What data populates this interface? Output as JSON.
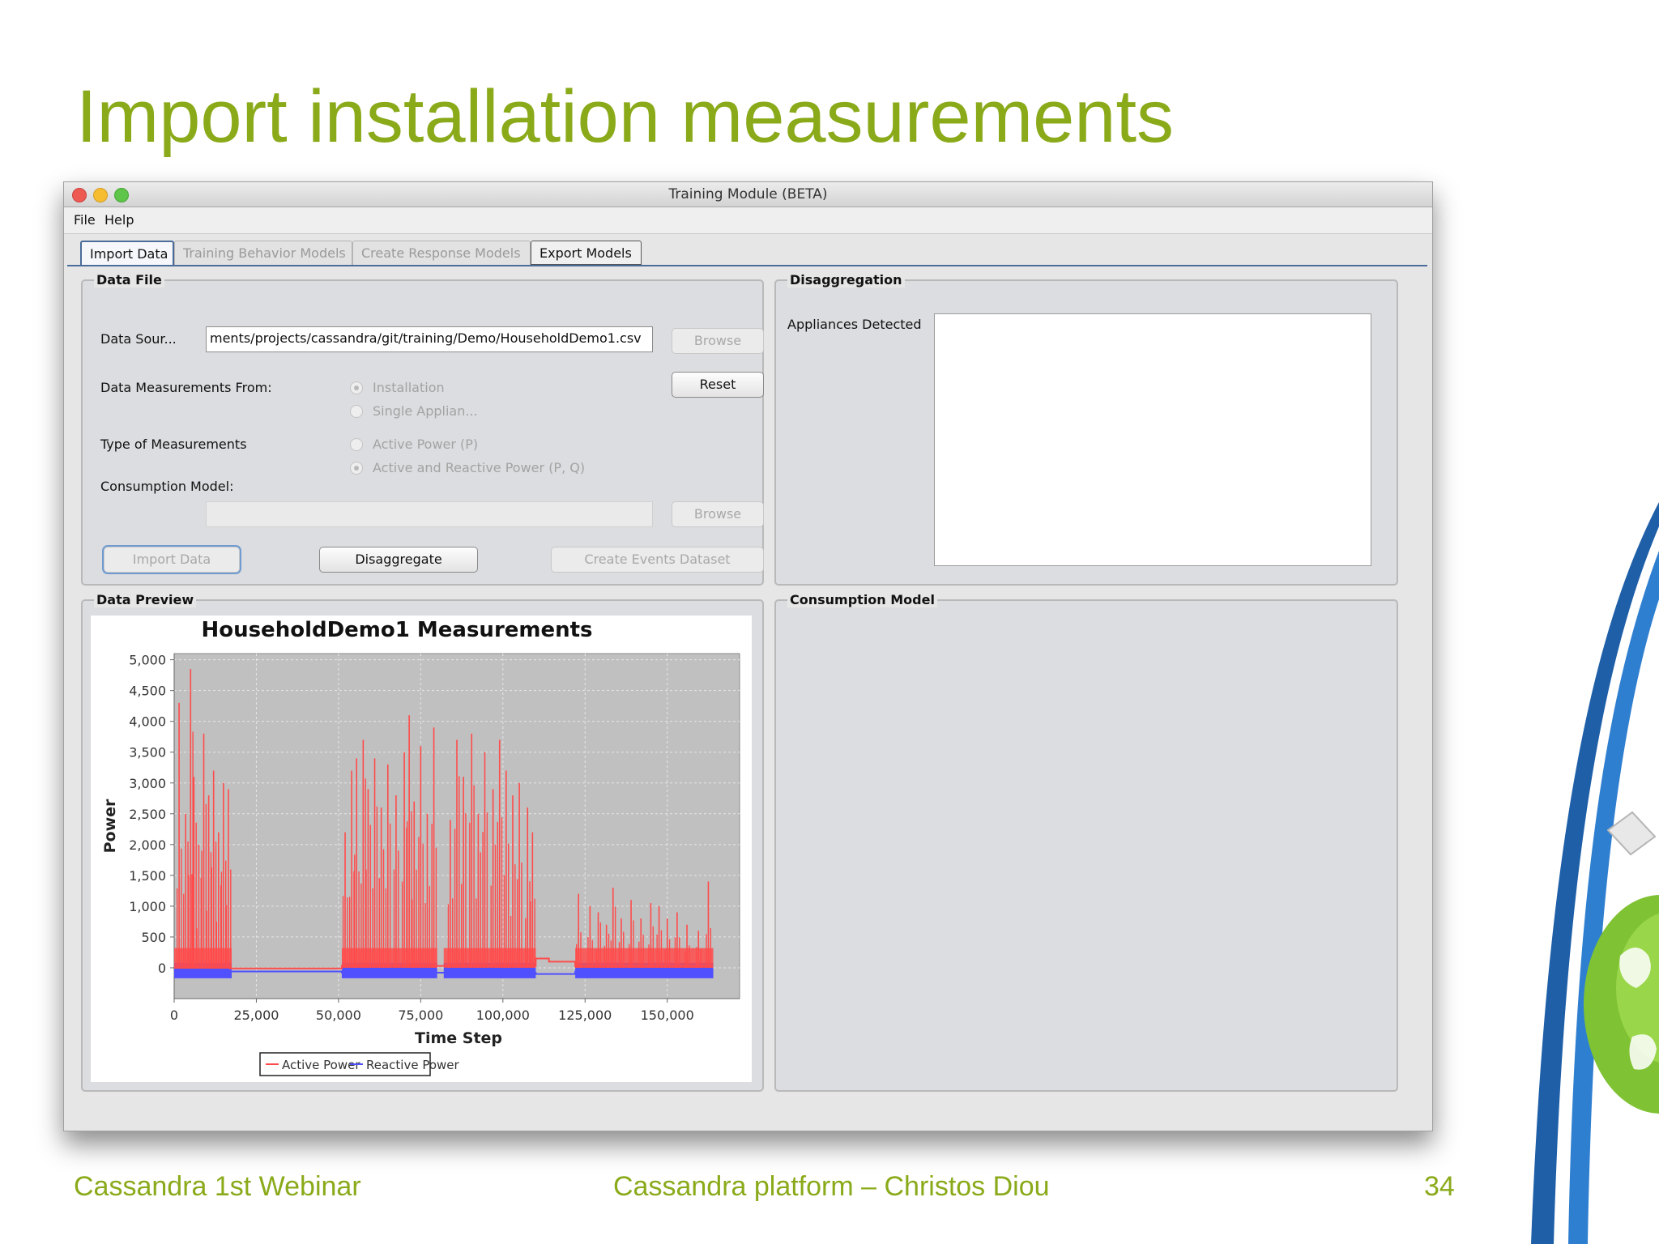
{
  "slide": {
    "title": "Import installation measurements",
    "footer_left": "Cassandra 1st Webinar",
    "footer_center": "Cassandra platform – Christos Diou",
    "page_number": "34"
  },
  "window": {
    "title": "Training Module (BETA)",
    "menu": [
      "File",
      "Help"
    ],
    "tabs": [
      {
        "label": "Import Data",
        "state": "active"
      },
      {
        "label": "Training Behavior Models",
        "state": "disabled"
      },
      {
        "label": "Create Response Models",
        "state": "disabled"
      },
      {
        "label": "Export Models",
        "state": "enabled"
      }
    ]
  },
  "data_file": {
    "group_title": "Data File",
    "source_label": "Data Sour...",
    "source_value": "ments/projects/cassandra/git/training/Demo/HouseholdDemo1.csv",
    "browse_label": "Browse",
    "reset_label": "Reset",
    "measurements_from_label": "Data Measurements From:",
    "measurements_from_options": [
      "Installation",
      "Single Applian..."
    ],
    "measurements_from_selected": "Installation",
    "type_label": "Type of Measurements",
    "type_options": [
      "Active Power (P)",
      "Active and Reactive Power (P, Q)"
    ],
    "type_selected": "Active and Reactive Power (P, Q)",
    "consumption_model_label": "Consumption Model:",
    "consumption_model_value": "",
    "browse2_label": "Browse",
    "import_button": "Import Data",
    "disaggregate_button": "Disaggregate",
    "create_events_button": "Create Events Dataset"
  },
  "disaggregation": {
    "group_title": "Disaggregation",
    "appliances_label": "Appliances Detected"
  },
  "data_preview": {
    "group_title": "Data Preview"
  },
  "consumption_model": {
    "group_title": "Consumption Model"
  },
  "chart_data": {
    "type": "line",
    "title": "HouseholdDemo1 Measurements",
    "xlabel": "Time Step",
    "ylabel": "Power",
    "xlim": [
      0,
      172000
    ],
    "ylim": [
      -500,
      5100
    ],
    "x_ticks": [
      0,
      25000,
      50000,
      75000,
      100000,
      125000,
      150000
    ],
    "x_tick_labels": [
      "0",
      "25,000",
      "50,000",
      "75,000",
      "100,000",
      "125,000",
      "150,000"
    ],
    "y_ticks": [
      0,
      500,
      1000,
      1500,
      2000,
      2500,
      3000,
      3500,
      4000,
      4500,
      5000
    ],
    "y_tick_labels": [
      "0",
      "500",
      "1,000",
      "1,500",
      "2,000",
      "2,500",
      "3,000",
      "3,500",
      "4,000",
      "4,500",
      "5,000"
    ],
    "grid": true,
    "legend_position": "bottom",
    "series": [
      {
        "name": "Active Power",
        "color": "#ff4b4b",
        "baseline_segments": [
          [
            0,
            17000,
            0
          ],
          [
            17000,
            51000,
            -10
          ],
          [
            51000,
            110000,
            30
          ],
          [
            110000,
            114000,
            150
          ],
          [
            114000,
            122000,
            100
          ],
          [
            122000,
            164000,
            20
          ]
        ],
        "active_ranges": [
          [
            0,
            17500
          ],
          [
            51000,
            80000
          ],
          [
            82000,
            110000
          ],
          [
            122000,
            164000
          ]
        ],
        "peaks": [
          [
            1500,
            4300
          ],
          [
            3500,
            2500
          ],
          [
            5000,
            4850
          ],
          [
            6000,
            3100
          ],
          [
            7500,
            2000
          ],
          [
            9000,
            3800
          ],
          [
            10500,
            2800
          ],
          [
            12000,
            3200
          ],
          [
            13500,
            2200
          ],
          [
            15000,
            3000
          ],
          [
            16500,
            2900
          ],
          [
            52000,
            2200
          ],
          [
            54000,
            3200
          ],
          [
            55500,
            3400
          ],
          [
            57500,
            3700
          ],
          [
            59000,
            2900
          ],
          [
            61000,
            3400
          ],
          [
            63000,
            2600
          ],
          [
            65000,
            3300
          ],
          [
            67500,
            2800
          ],
          [
            70000,
            3500
          ],
          [
            71500,
            4100
          ],
          [
            73000,
            2700
          ],
          [
            75000,
            3600
          ],
          [
            77000,
            2500
          ],
          [
            79000,
            3900
          ],
          [
            84000,
            2400
          ],
          [
            86000,
            3700
          ],
          [
            88000,
            3100
          ],
          [
            90500,
            3800
          ],
          [
            92500,
            2500
          ],
          [
            94500,
            3500
          ],
          [
            97000,
            2900
          ],
          [
            99000,
            3700
          ],
          [
            101000,
            3200
          ],
          [
            103000,
            2800
          ],
          [
            105000,
            3000
          ],
          [
            107500,
            2600
          ],
          [
            109000,
            2200
          ],
          [
            123000,
            1200
          ],
          [
            126500,
            1000
          ],
          [
            129000,
            900
          ],
          [
            131500,
            700
          ],
          [
            133500,
            1300
          ],
          [
            136000,
            800
          ],
          [
            139000,
            1100
          ],
          [
            142000,
            800
          ],
          [
            145000,
            1050
          ],
          [
            147500,
            1000
          ],
          [
            150000,
            800
          ],
          [
            153000,
            900
          ],
          [
            156000,
            700
          ],
          [
            159500,
            600
          ],
          [
            162500,
            1400
          ]
        ]
      },
      {
        "name": "Reactive Power",
        "color": "#5050ff",
        "baseline_segments": [
          [
            0,
            17000,
            -100
          ],
          [
            17000,
            51000,
            -60
          ],
          [
            51000,
            110000,
            -80
          ],
          [
            110000,
            122000,
            -100
          ],
          [
            122000,
            164000,
            -60
          ]
        ],
        "band": [
          -170,
          80
        ]
      }
    ]
  }
}
